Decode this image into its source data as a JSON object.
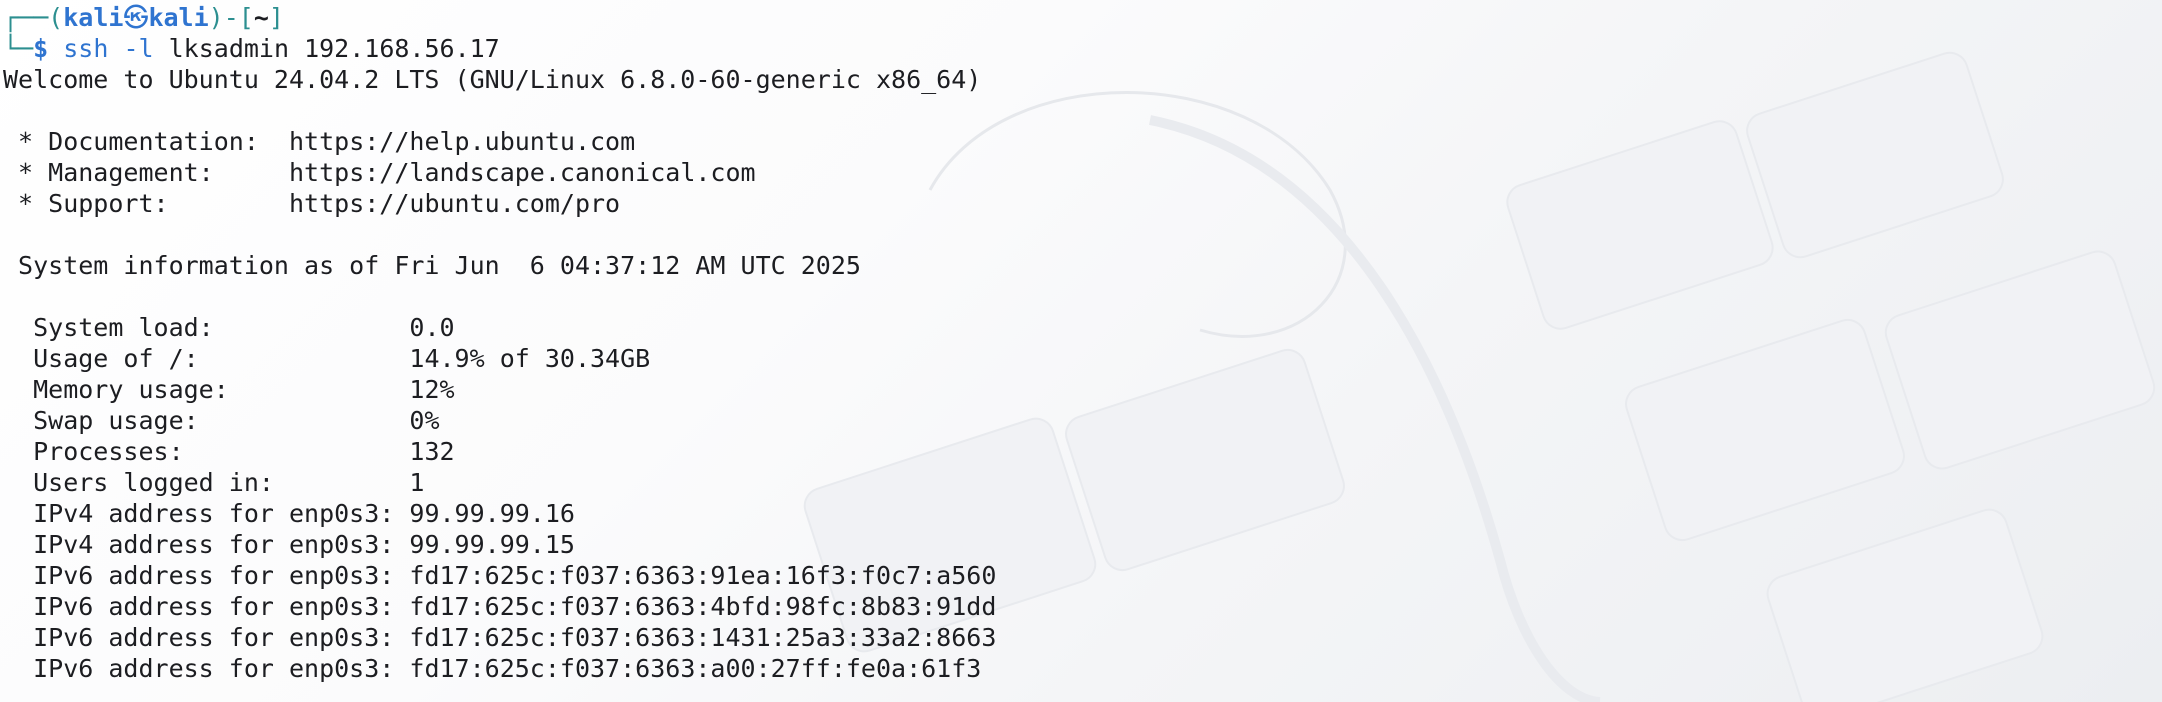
{
  "prompt": {
    "top_left": "┌──(",
    "user": "kali",
    "at_symbol": "㉿",
    "host": "kali",
    "mid": ")-[",
    "dir": "~",
    "end": "]",
    "bottom_left": "└─",
    "dollar": "$",
    "command": "ssh -l",
    "args": "lksadmin 192.168.56.17"
  },
  "welcome": "Welcome to Ubuntu 24.04.2 LTS (GNU/Linux 6.8.0-60-generic x86_64)",
  "links": [
    {
      "label": " * Documentation:  ",
      "url": "https://help.ubuntu.com"
    },
    {
      "label": " * Management:     ",
      "url": "https://landscape.canonical.com"
    },
    {
      "label": " * Support:        ",
      "url": "https://ubuntu.com/pro"
    }
  ],
  "sysinfo_header": " System information as of Fri Jun  6 04:37:12 AM UTC 2025",
  "sysinfo": [
    {
      "label": "  System load:             ",
      "value": "0.0"
    },
    {
      "label": "  Usage of /:              ",
      "value": "14.9% of 30.34GB"
    },
    {
      "label": "  Memory usage:            ",
      "value": "12%"
    },
    {
      "label": "  Swap usage:              ",
      "value": "0%"
    },
    {
      "label": "  Processes:               ",
      "value": "132"
    },
    {
      "label": "  Users logged in:         ",
      "value": "1"
    },
    {
      "label": "  IPv4 address for enp0s3: ",
      "value": "99.99.99.16"
    },
    {
      "label": "  IPv4 address for enp0s3: ",
      "value": "99.99.99.15"
    },
    {
      "label": "  IPv6 address for enp0s3: ",
      "value": "fd17:625c:f037:6363:91ea:16f3:f0c7:a560"
    },
    {
      "label": "  IPv6 address for enp0s3: ",
      "value": "fd17:625c:f037:6363:4bfd:98fc:8b83:91dd"
    },
    {
      "label": "  IPv6 address for enp0s3: ",
      "value": "fd17:625c:f037:6363:1431:25a3:33a2:8663"
    },
    {
      "label": "  IPv6 address for enp0s3: ",
      "value": "fd17:625c:f037:6363:a00:27ff:fe0a:61f3"
    }
  ],
  "colors": {
    "prompt_frame": "#2c8f90",
    "prompt_user": "#2f74d0",
    "text": "#1c1d21"
  }
}
